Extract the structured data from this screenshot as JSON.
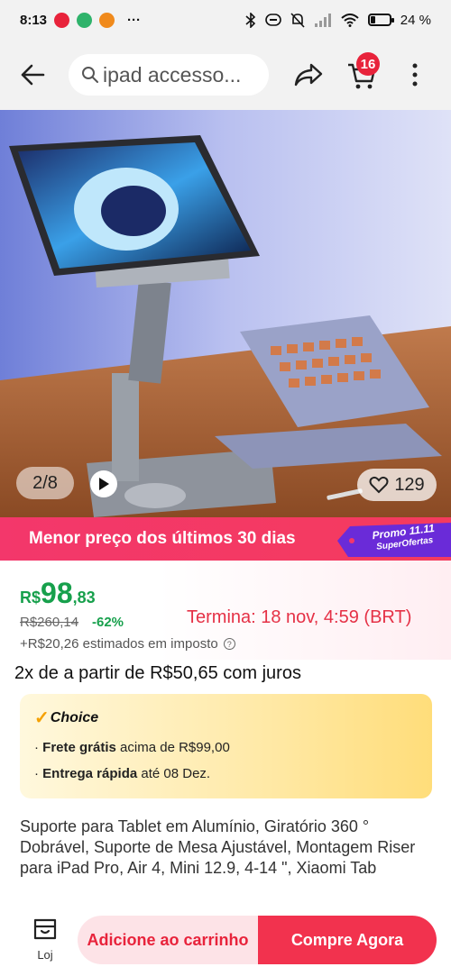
{
  "status_bar": {
    "time": "8:13",
    "more": "···",
    "battery": "24 %"
  },
  "search": {
    "text": "ipad accesso..."
  },
  "cart": {
    "count": "16"
  },
  "gallery": {
    "counter": "2/8",
    "likes": "129"
  },
  "promo": {
    "lowest_price": "Menor preço dos últimos 30 dias",
    "tag_title": "Promo 11.11",
    "tag_sub": "SuperOfertas"
  },
  "price": {
    "currency": "R$",
    "integer": "98",
    "decimal": ",83",
    "old_price": "R$260,14",
    "discount": "-62%",
    "ends": "Termina: 18 nov, 4:59 (BRT)",
    "tax": "+R$20,26 estimados em imposto"
  },
  "installments": "2x de a partir de R$50,65 com juros",
  "choice": {
    "title": "Choice",
    "shipping_bold": "Frete grátis",
    "shipping_rest": " acima de R$99,00",
    "delivery_bold": "Entrega rápida",
    "delivery_rest": " até 08 Dez."
  },
  "product_title": "Suporte para Tablet em Alumínio, Giratório 360 ° Dobrável, Suporte de Mesa Ajustável, Montagem Riser para iPad Pro, Air 4, Mini 12.9, 4-14 \", Xiaomi Tab",
  "bottom": {
    "store_label": "Loj",
    "add_to_cart": "Adicione ao carrinho",
    "buy_now": "Compre Agora"
  },
  "icons": [
    "bluetooth-icon",
    "dnd-icon",
    "mute-icon",
    "signal-icon",
    "wifi-icon",
    "battery-icon",
    "back-arrow-icon",
    "search-icon",
    "share-icon",
    "cart-icon",
    "more-vertical-icon",
    "play-icon",
    "heart-icon",
    "info-icon",
    "check-icon",
    "store-icon"
  ],
  "colors": {
    "accent": "#f2324e",
    "price_green": "#17a04c",
    "promo_pink": "#f3376b"
  }
}
